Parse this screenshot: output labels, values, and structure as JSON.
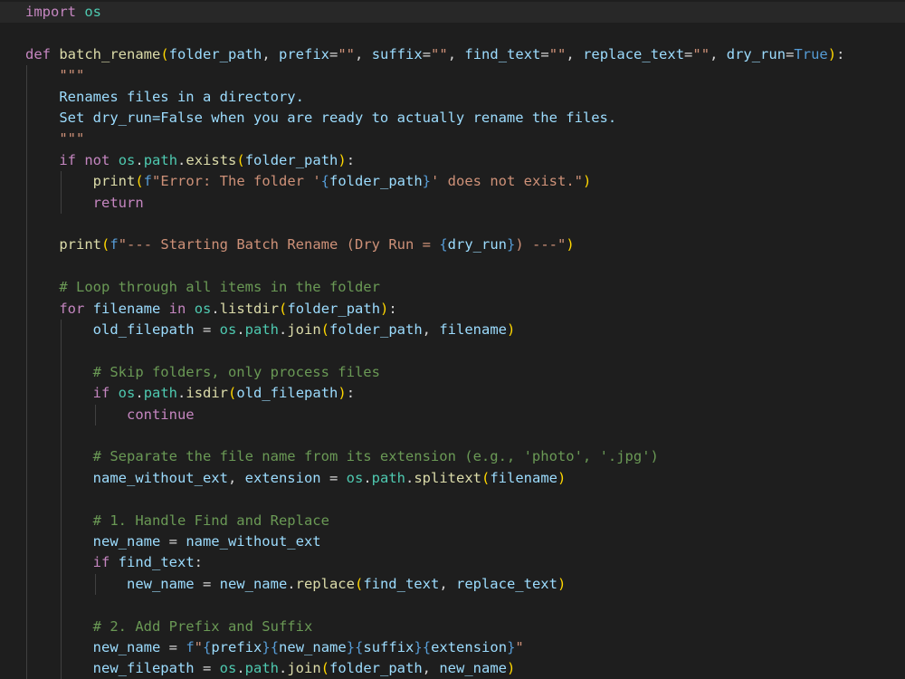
{
  "editor": {
    "language": "python",
    "lines": [
      "import os",
      "",
      "def batch_rename(folder_path, prefix=\"\", suffix=\"\", find_text=\"\", replace_text=\"\", dry_run=True):",
      "    \"\"\"",
      "    Renames files in a directory.",
      "    Set dry_run=False when you are ready to actually rename the files.",
      "    \"\"\"",
      "    if not os.path.exists(folder_path):",
      "        print(f\"Error: The folder '{folder_path}' does not exist.\")",
      "        return",
      "",
      "    print(f\"--- Starting Batch Rename (Dry Run = {dry_run}) ---\")",
      "",
      "    # Loop through all items in the folder",
      "    for filename in os.listdir(folder_path):",
      "        old_filepath = os.path.join(folder_path, filename)",
      "",
      "        # Skip folders, only process files",
      "        if os.path.isdir(old_filepath):",
      "            continue",
      "",
      "        # Separate the file name from its extension (e.g., 'photo', '.jpg')",
      "        name_without_ext, extension = os.path.splitext(filename)",
      "",
      "        # 1. Handle Find and Replace",
      "        new_name = name_without_ext",
      "        if find_text:",
      "            new_name = new_name.replace(find_text, replace_text)",
      "",
      "        # 2. Add Prefix and Suffix",
      "        new_name = f\"{prefix}{new_name}{suffix}{extension}\"",
      "        new_filepath = os.path.join(folder_path, new_name)"
    ]
  },
  "colors": {
    "background": "#1e1e1e",
    "current_line": "#282828",
    "keyword": "#c586c0",
    "builtin_constant": "#569cd6",
    "function": "#dcdcaa",
    "variable": "#9cdcfe",
    "string": "#ce9178",
    "comment": "#6a9955",
    "module": "#4ec9b0"
  }
}
